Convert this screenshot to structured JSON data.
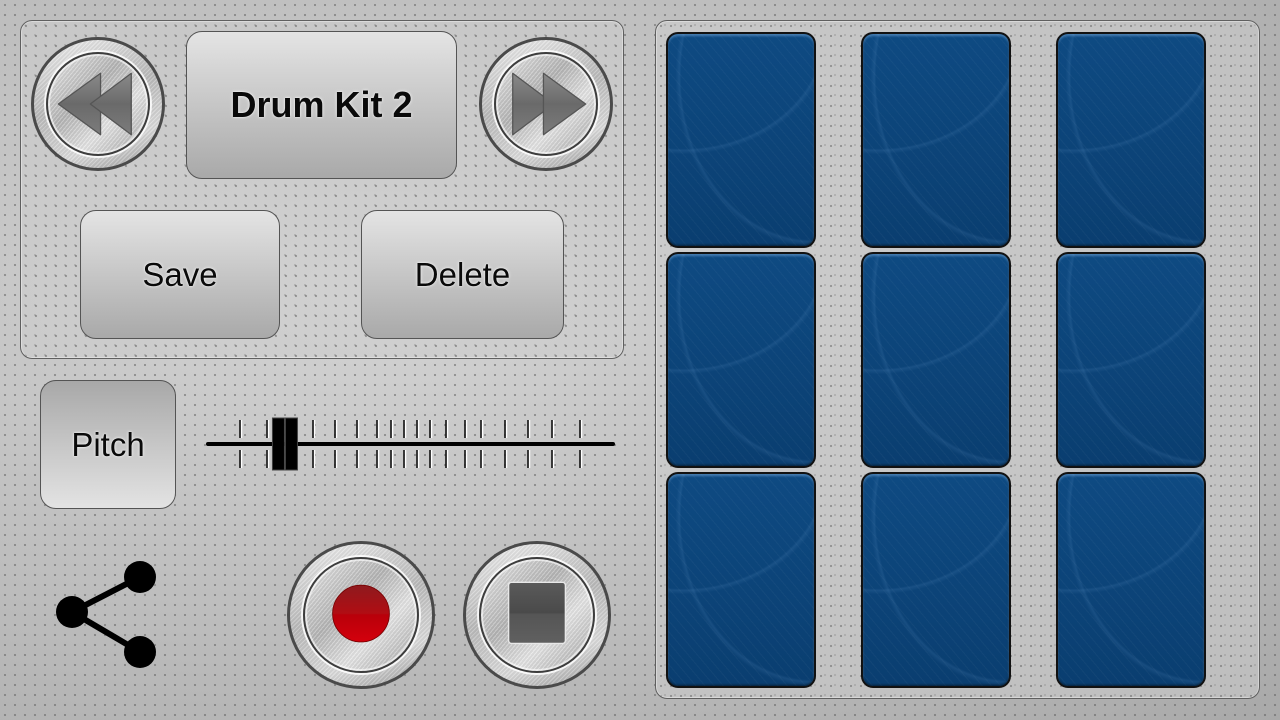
{
  "kit_selector": {
    "prev_icon": "rewind-icon",
    "current_kit": "Drum Kit 2",
    "next_icon": "fast-forward-icon"
  },
  "actions": {
    "save_label": "Save",
    "delete_label": "Delete"
  },
  "pitch": {
    "label": "Pitch",
    "value_fraction": 0.19
  },
  "transport": {
    "share_icon": "share-icon",
    "record_icon": "record-icon",
    "stop_icon": "stop-icon",
    "record_color": "#c8000a",
    "stop_color": "#505050"
  },
  "pads": {
    "rows": 3,
    "columns": 3,
    "color": "#0c4478",
    "items": [
      {
        "id": 1
      },
      {
        "id": 2
      },
      {
        "id": 3
      },
      {
        "id": 4
      },
      {
        "id": 5
      },
      {
        "id": 6
      },
      {
        "id": 7
      },
      {
        "id": 8
      },
      {
        "id": 9
      }
    ]
  }
}
